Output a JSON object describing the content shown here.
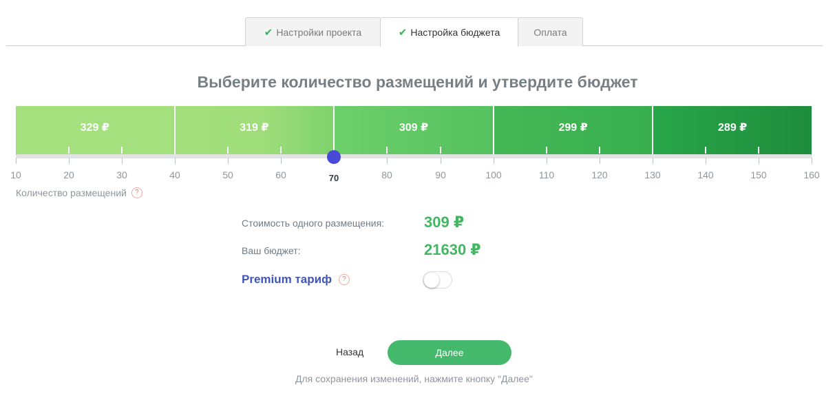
{
  "tabs": [
    {
      "label": "Настройки проекта",
      "checked": true,
      "active": false
    },
    {
      "label": "Настройка бюджета",
      "checked": true,
      "active": true
    },
    {
      "label": "Оплата",
      "checked": false,
      "active": false
    }
  ],
  "title": "Выберите количество размещений и утвердите бюджет",
  "price_segments": [
    {
      "label": "329 ₽",
      "from": 10,
      "to": 40
    },
    {
      "label": "319 ₽",
      "from": 40,
      "to": 70
    },
    {
      "label": "309 ₽",
      "from": 70,
      "to": 100
    },
    {
      "label": "299 ₽",
      "from": 100,
      "to": 130
    },
    {
      "label": "289 ₽",
      "from": 130,
      "to": 160
    }
  ],
  "slider": {
    "min": 10,
    "max": 160,
    "step_labels": [
      "10",
      "20",
      "30",
      "40",
      "50",
      "60",
      "70",
      "80",
      "90",
      "100",
      "110",
      "120",
      "130",
      "140",
      "150",
      "160"
    ],
    "value": 70,
    "value_label": "70"
  },
  "quantity_label": "Количество размещений",
  "help_glyph": "?",
  "cost": {
    "per_placement_label": "Стоимость одного размещения:",
    "per_placement_value": "309 ₽",
    "budget_label": "Ваш бюджет:",
    "budget_value": "21630 ₽"
  },
  "premium": {
    "label": "Premium тариф",
    "enabled": false
  },
  "actions": {
    "back_label": "Назад",
    "next_label": "Далее",
    "hint": "Для сохранения изменений, нажмите кнопку \"Далее\""
  },
  "colors": {
    "accent_green": "#42b661",
    "slider_handle": "#4949d7",
    "premium_blue": "#3f55b8"
  }
}
